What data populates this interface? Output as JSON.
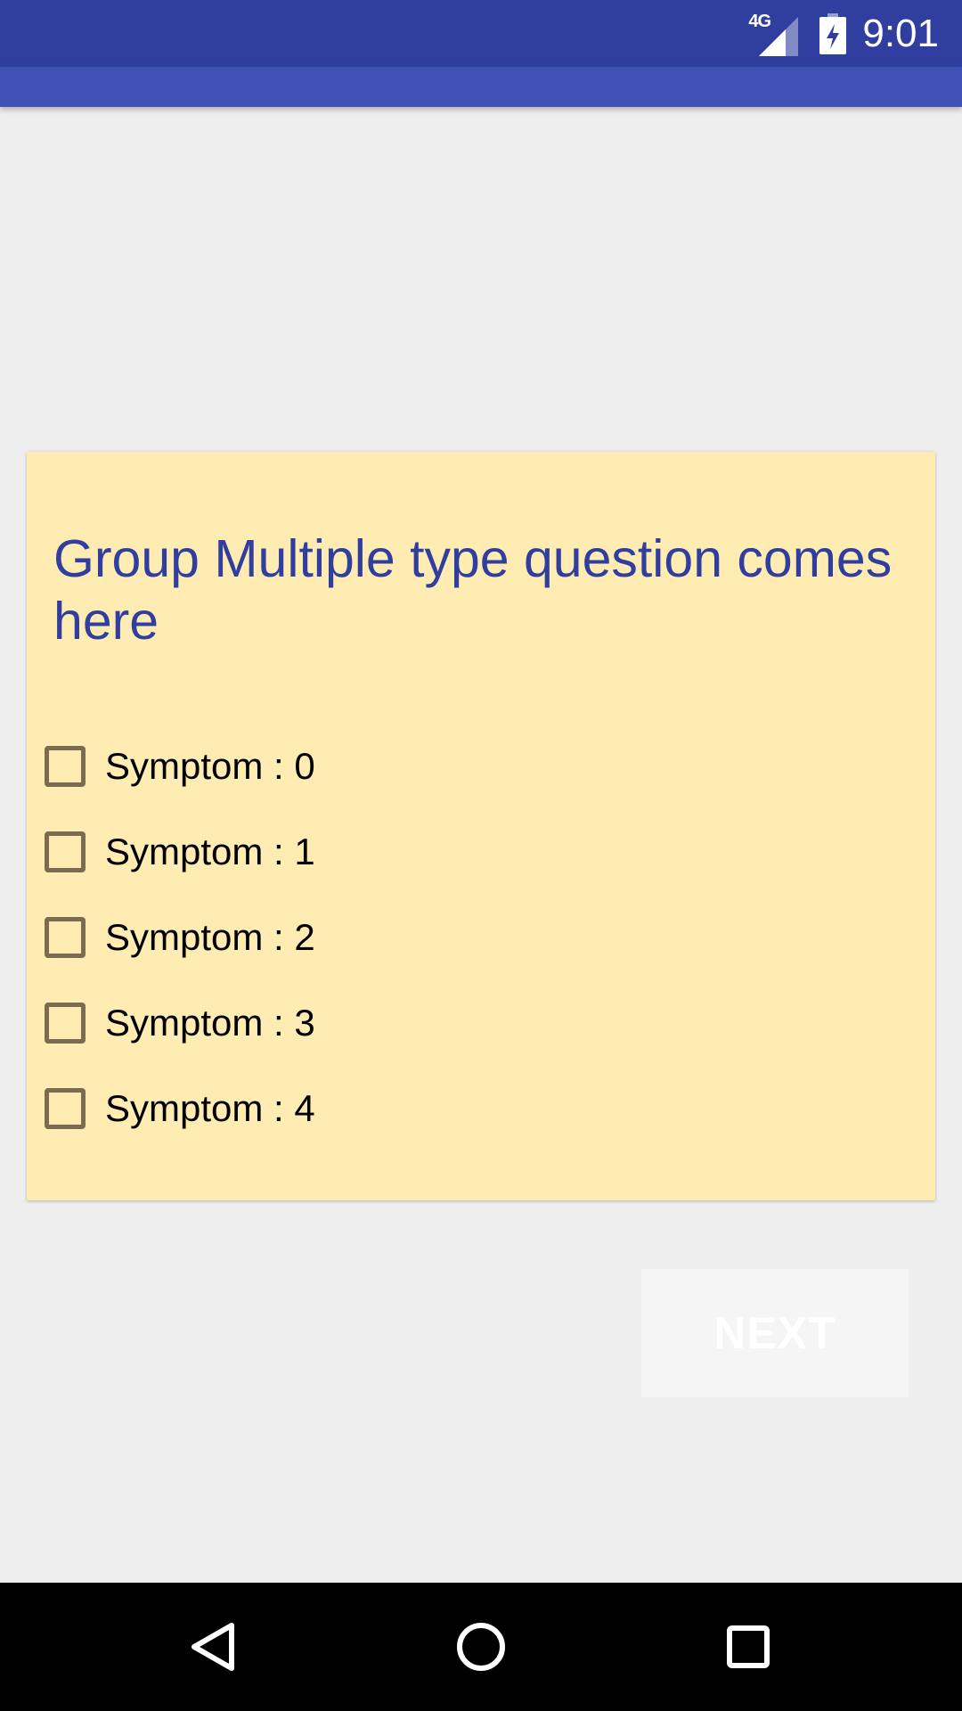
{
  "status_bar": {
    "network_type": "4G",
    "time": "9:01",
    "icons": [
      "signal-icon",
      "battery-charging-icon"
    ]
  },
  "question": {
    "text": "Group Multiple type question comes here",
    "options": [
      {
        "label": "Symptom : 0",
        "checked": false
      },
      {
        "label": "Symptom : 1",
        "checked": false
      },
      {
        "label": "Symptom : 2",
        "checked": false
      },
      {
        "label": "Symptom : 3",
        "checked": false
      },
      {
        "label": "Symptom : 4",
        "checked": false
      }
    ]
  },
  "actions": {
    "next_label": "NEXT"
  },
  "nav_bar": {
    "icons": [
      "back-icon",
      "home-icon",
      "recents-icon"
    ]
  },
  "colors": {
    "status_bar": "#303f9f",
    "app_bar": "#3f51b5",
    "card_background": "#ffecb3",
    "question_text": "#303f9f",
    "page_background": "#eeeeee"
  }
}
